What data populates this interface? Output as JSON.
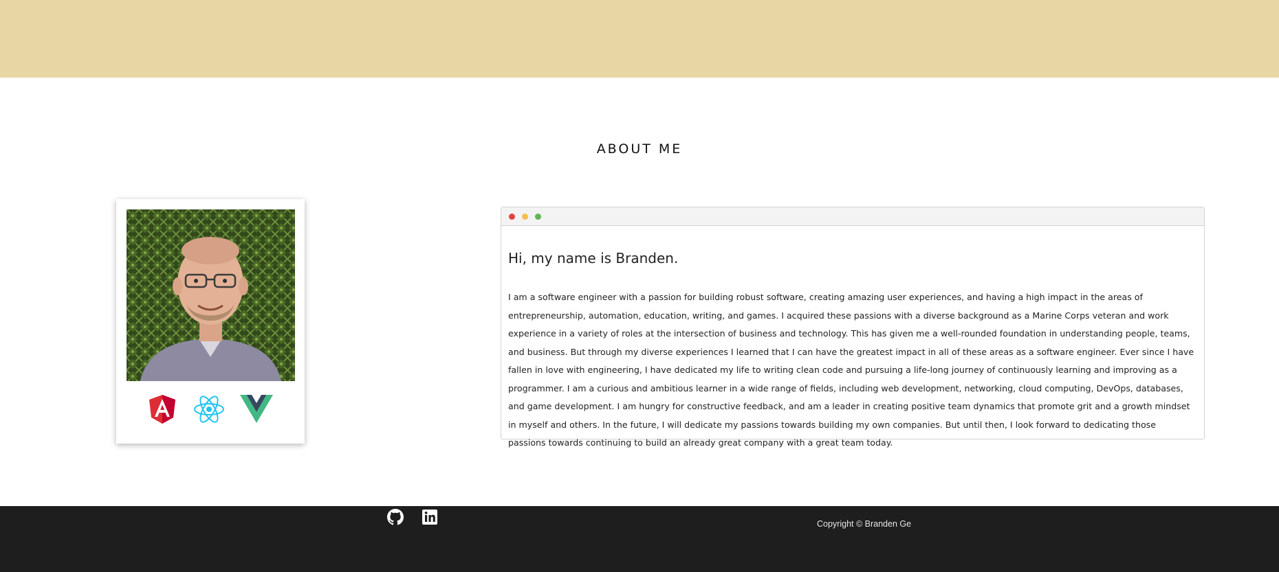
{
  "header": {
    "background_color": "#e8d6a4"
  },
  "about": {
    "section_title": "ABOUT ME",
    "photo_alt": "Portrait photo",
    "tech_icons": [
      "angular-icon",
      "react-icon",
      "vue-icon"
    ]
  },
  "window": {
    "dots": [
      "#e0443e",
      "#f5bf4f",
      "#62b556"
    ],
    "greeting": "Hi, my name is Branden.",
    "bio": "I am a software engineer with a passion for building robust software, creating amazing user experiences, and having a high impact in the areas of entrepreneurship, automation, education, writing, and games. I acquired these passions with a diverse background as a Marine Corps veteran and work experience in a variety of roles at the intersection of business and technology. This has given me a well-rounded foundation in understanding people, teams, and business. But through my diverse experiences I learned that I can have the greatest impact in all of these areas as a software engineer. Ever since I have fallen in love with engineering, I have dedicated my life to writing clean code and pursuing a life-long journey of continuously learning and improving as a programmer. I am a curious and ambitious learner in a wide range of fields, including web development, networking, cloud computing, DevOps, databases, and game development. I am hungry for constructive feedback, and am a leader in creating positive team dynamics that promote grit and a growth mindset in myself and others. In the future, I will dedicate my passions towards building my own companies. But until then, I look forward to dedicating those passions towards continuing to build an already great company with a great team today."
  },
  "footer": {
    "social_icons": [
      "github-icon",
      "linkedin-icon"
    ],
    "copyright": "Copyright © Branden Ge"
  }
}
